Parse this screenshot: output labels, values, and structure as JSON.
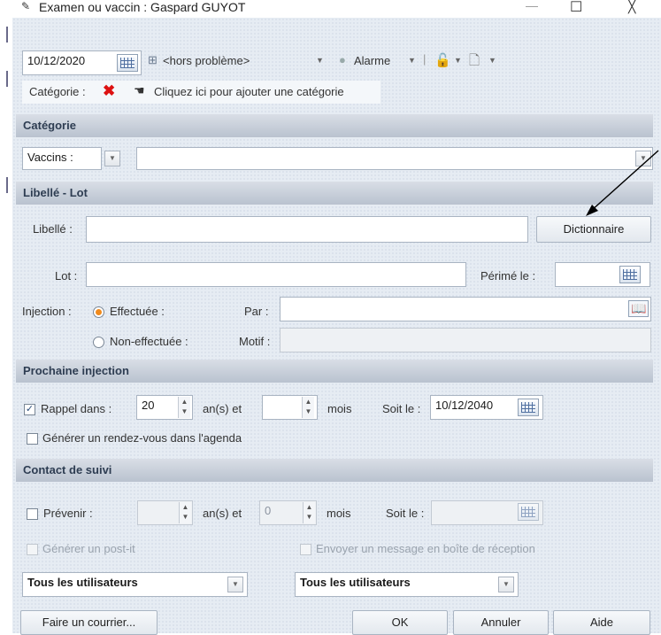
{
  "window": {
    "title": "Examen ou vaccin : Gaspard GUYOT",
    "minimize": "—",
    "maximize": "☐",
    "close": "╳"
  },
  "toolbar": {
    "date": "10/12/2020",
    "status": "<hors problème>",
    "alarm": "Alarme"
  },
  "category_bar": {
    "label": "Catégorie :",
    "add_text": "Cliquez ici pour ajouter une catégorie"
  },
  "sections": {
    "categorie": "Catégorie",
    "libelle_lot": "Libellé - Lot",
    "prochaine": "Prochaine injection",
    "contact": "Contact de suivi"
  },
  "categorie": {
    "vaccins_label": "Vaccins :",
    "value": ""
  },
  "libelle": {
    "label": "Libellé :",
    "value": "",
    "dict_button": "Dictionnaire"
  },
  "lot": {
    "label": "Lot :",
    "value": "",
    "perime_label": "Périmé le :",
    "perime_value": ""
  },
  "injection": {
    "label": "Injection :",
    "effectuee": "Effectuée :",
    "par_label": "Par :",
    "par_value": "",
    "non_effectuee": "Non-effectuée :",
    "motif_label": "Motif :",
    "motif_value": ""
  },
  "prochaine": {
    "rappel_label": "Rappel dans :",
    "rappel_checked": true,
    "years": "20",
    "ans_label": "an(s) et",
    "months": "",
    "mois_label": "mois",
    "soit_label": "Soit le :",
    "soit_value": "10/12/2040",
    "rdv_label": "Générer un rendez-vous dans l'agenda"
  },
  "contact": {
    "prevenir_label": "Prévenir :",
    "years": "",
    "ans_label": "an(s) et",
    "months": "0",
    "mois_label": "mois",
    "soit_label": "Soit le :",
    "soit_value": "",
    "postit_label": "Générer un post-it",
    "envoyer_label": "Envoyer un message en boîte de réception",
    "users1": "Tous les utilisateurs",
    "users2": "Tous les utilisateurs"
  },
  "buttons": {
    "courrier": "Faire un courrier...",
    "ok": "OK",
    "annuler": "Annuler",
    "aide": "Aide"
  }
}
